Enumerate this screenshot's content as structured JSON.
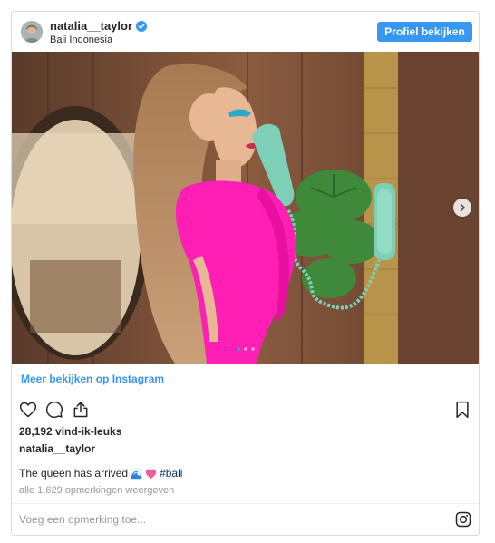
{
  "header": {
    "username": "natalia__taylor",
    "location": "Bali Indonesia",
    "profile_button": "Profiel bekijken",
    "verified_icon": "verified-badge-icon"
  },
  "post": {
    "image_alt": "Woman in pink dress on teal telephone",
    "carousel": {
      "count": 3,
      "active_index": 0
    }
  },
  "view_more_label": "Meer bekijken op Instagram",
  "actions": {
    "icons": [
      "heart-icon",
      "comment-icon",
      "share-icon",
      "bookmark-icon"
    ]
  },
  "likes_text": "28,192 vind-ik-leuks",
  "poster_username": "natalia__taylor",
  "caption": {
    "text": "The queen has arrived",
    "emojis": [
      "wave-emoji",
      "sparkling-heart-emoji"
    ],
    "hashtag": "#bali"
  },
  "comments_link": "alle 1,629 opmerkingen weergeven",
  "comment_input": {
    "placeholder": "Voeg een opmerking toe..."
  },
  "colors": {
    "accent": "#3897f0",
    "hashtag": "#003569",
    "muted": "#999999"
  }
}
